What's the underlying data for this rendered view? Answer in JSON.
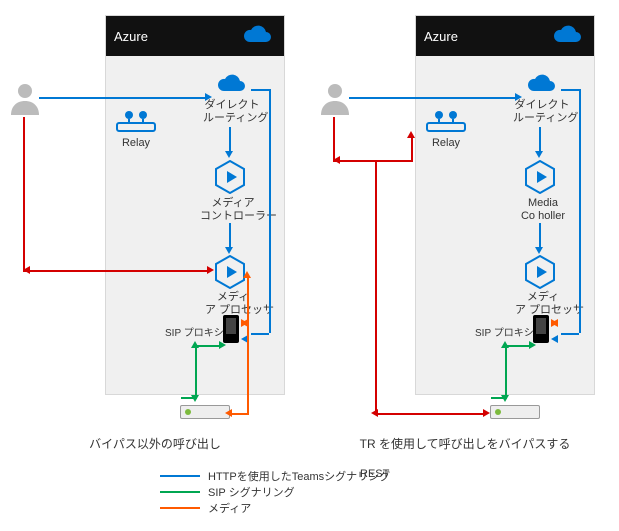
{
  "azure_title": "Azure",
  "relay_label": "Relay",
  "direct_routing_label": "ダイレクト\nルーティング",
  "media_controller_label_left": "メディア\nコントローラー",
  "media_controller_label_right": "Media\nCo holler",
  "media_processor_label": "メディ\nア プロセッサ",
  "sip_proxy_label": "SIP プロキシ",
  "caption_left": "バイパス以外の呼び出し",
  "caption_right": "TR を使用して呼び出しをバイパスする",
  "legend": {
    "http": "HTTPを使用したTeamsシグナリング",
    "sip": "SIP シグナリング",
    "media": "メディア",
    "rest": "REST"
  },
  "colors": {
    "blue": "#0078d4",
    "green": "#00a651",
    "orange": "#ff5a00",
    "red": "#d40000"
  }
}
